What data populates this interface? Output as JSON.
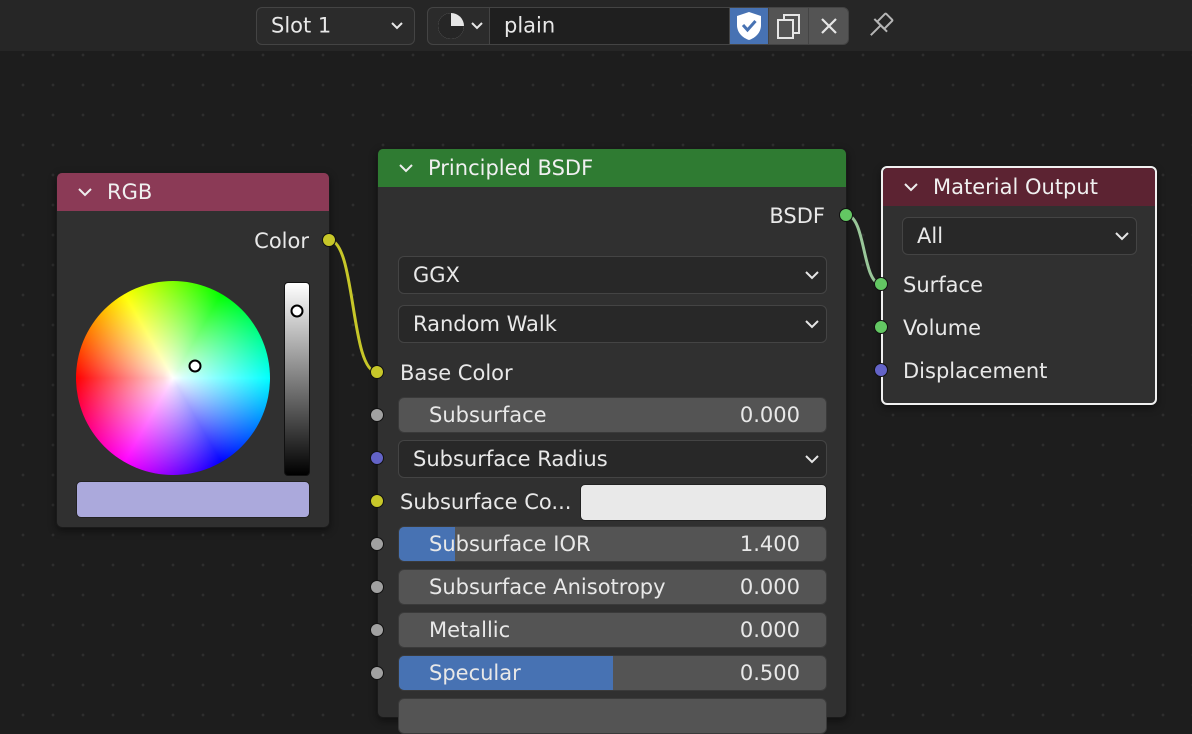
{
  "header": {
    "slot_label": "Slot 1",
    "material_name": "plain"
  },
  "rgb_node": {
    "title": "RGB",
    "output_label": "Color",
    "swatch_color": "#aba9dc",
    "header_color": "#8b3a56"
  },
  "bsdf_node": {
    "title": "Principled BSDF",
    "output_label": "BSDF",
    "header_color": "#2f7b32",
    "distribution": "GGX",
    "subsurface_method": "Random Walk",
    "inputs": {
      "base_color": "Base Color",
      "subsurface": {
        "label": "Subsurface",
        "value": "0.000"
      },
      "subsurface_radius": "Subsurface Radius",
      "subsurface_color": {
        "label": "Subsurface Co...",
        "swatch": "#e9e9e9"
      },
      "subsurface_ior": {
        "label": "Subsurface IOR",
        "value": "1.400",
        "fill_fraction": 0.13
      },
      "subsurface_anisotropy": {
        "label": "Subsurface Anisotropy",
        "value": "0.000"
      },
      "metallic": {
        "label": "Metallic",
        "value": "0.000"
      },
      "specular": {
        "label": "Specular",
        "value": "0.500",
        "fill_fraction": 0.5
      }
    }
  },
  "output_node": {
    "title": "Material Output",
    "header_color": "#5c2332",
    "target": "All",
    "inputs": {
      "surface": "Surface",
      "volume": "Volume",
      "displacement": "Displacement"
    }
  }
}
